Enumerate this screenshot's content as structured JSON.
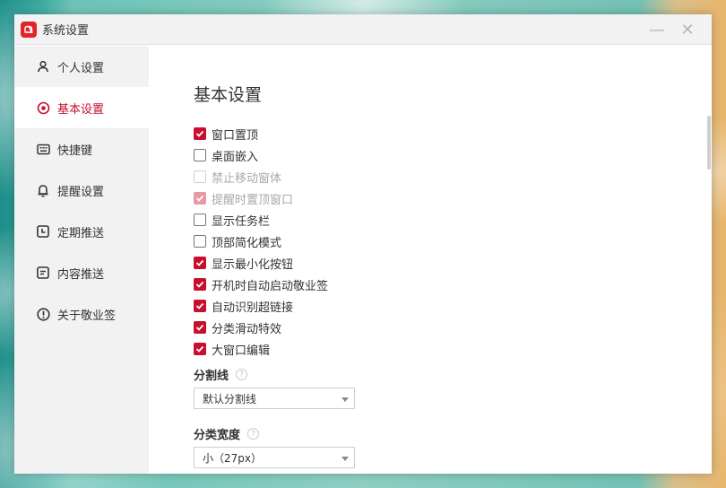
{
  "window": {
    "title": "系统设置",
    "minimize": "—",
    "close": "✕"
  },
  "sidebar": {
    "items": [
      {
        "label": "个人设置",
        "icon": "user-icon"
      },
      {
        "label": "基本设置",
        "icon": "settings-icon",
        "active": true
      },
      {
        "label": "快捷键",
        "icon": "keyboard-icon"
      },
      {
        "label": "提醒设置",
        "icon": "bell-icon"
      },
      {
        "label": "定期推送",
        "icon": "clock-icon"
      },
      {
        "label": "内容推送",
        "icon": "document-icon"
      },
      {
        "label": "关于敬业签",
        "icon": "info-icon"
      }
    ]
  },
  "main": {
    "title": "基本设置",
    "options": [
      {
        "label": "窗口置顶",
        "checked": true,
        "disabled": false
      },
      {
        "label": "桌面嵌入",
        "checked": false,
        "disabled": false
      },
      {
        "label": "禁止移动窗体",
        "checked": false,
        "disabled": true
      },
      {
        "label": "提醒时置顶窗口",
        "checked": true,
        "disabled": true
      },
      {
        "label": "显示任务栏",
        "checked": false,
        "disabled": false
      },
      {
        "label": "顶部简化模式",
        "checked": false,
        "disabled": false
      },
      {
        "label": "显示最小化按钮",
        "checked": true,
        "disabled": false
      },
      {
        "label": "开机时自动启动敬业签",
        "checked": true,
        "disabled": false
      },
      {
        "label": "自动识别超链接",
        "checked": true,
        "disabled": false
      },
      {
        "label": "分类滑动特效",
        "checked": true,
        "disabled": false
      },
      {
        "label": "大窗口编辑",
        "checked": true,
        "disabled": false
      }
    ],
    "divider": {
      "label": "分割线",
      "help": "?",
      "value": "默认分割线"
    },
    "category_width": {
      "label": "分类宽度",
      "help": "?",
      "value": "小（27px）"
    }
  },
  "colors": {
    "accent": "#c8102e",
    "sidebar_bg": "#f2f2f2",
    "logo": "#e0242c"
  }
}
